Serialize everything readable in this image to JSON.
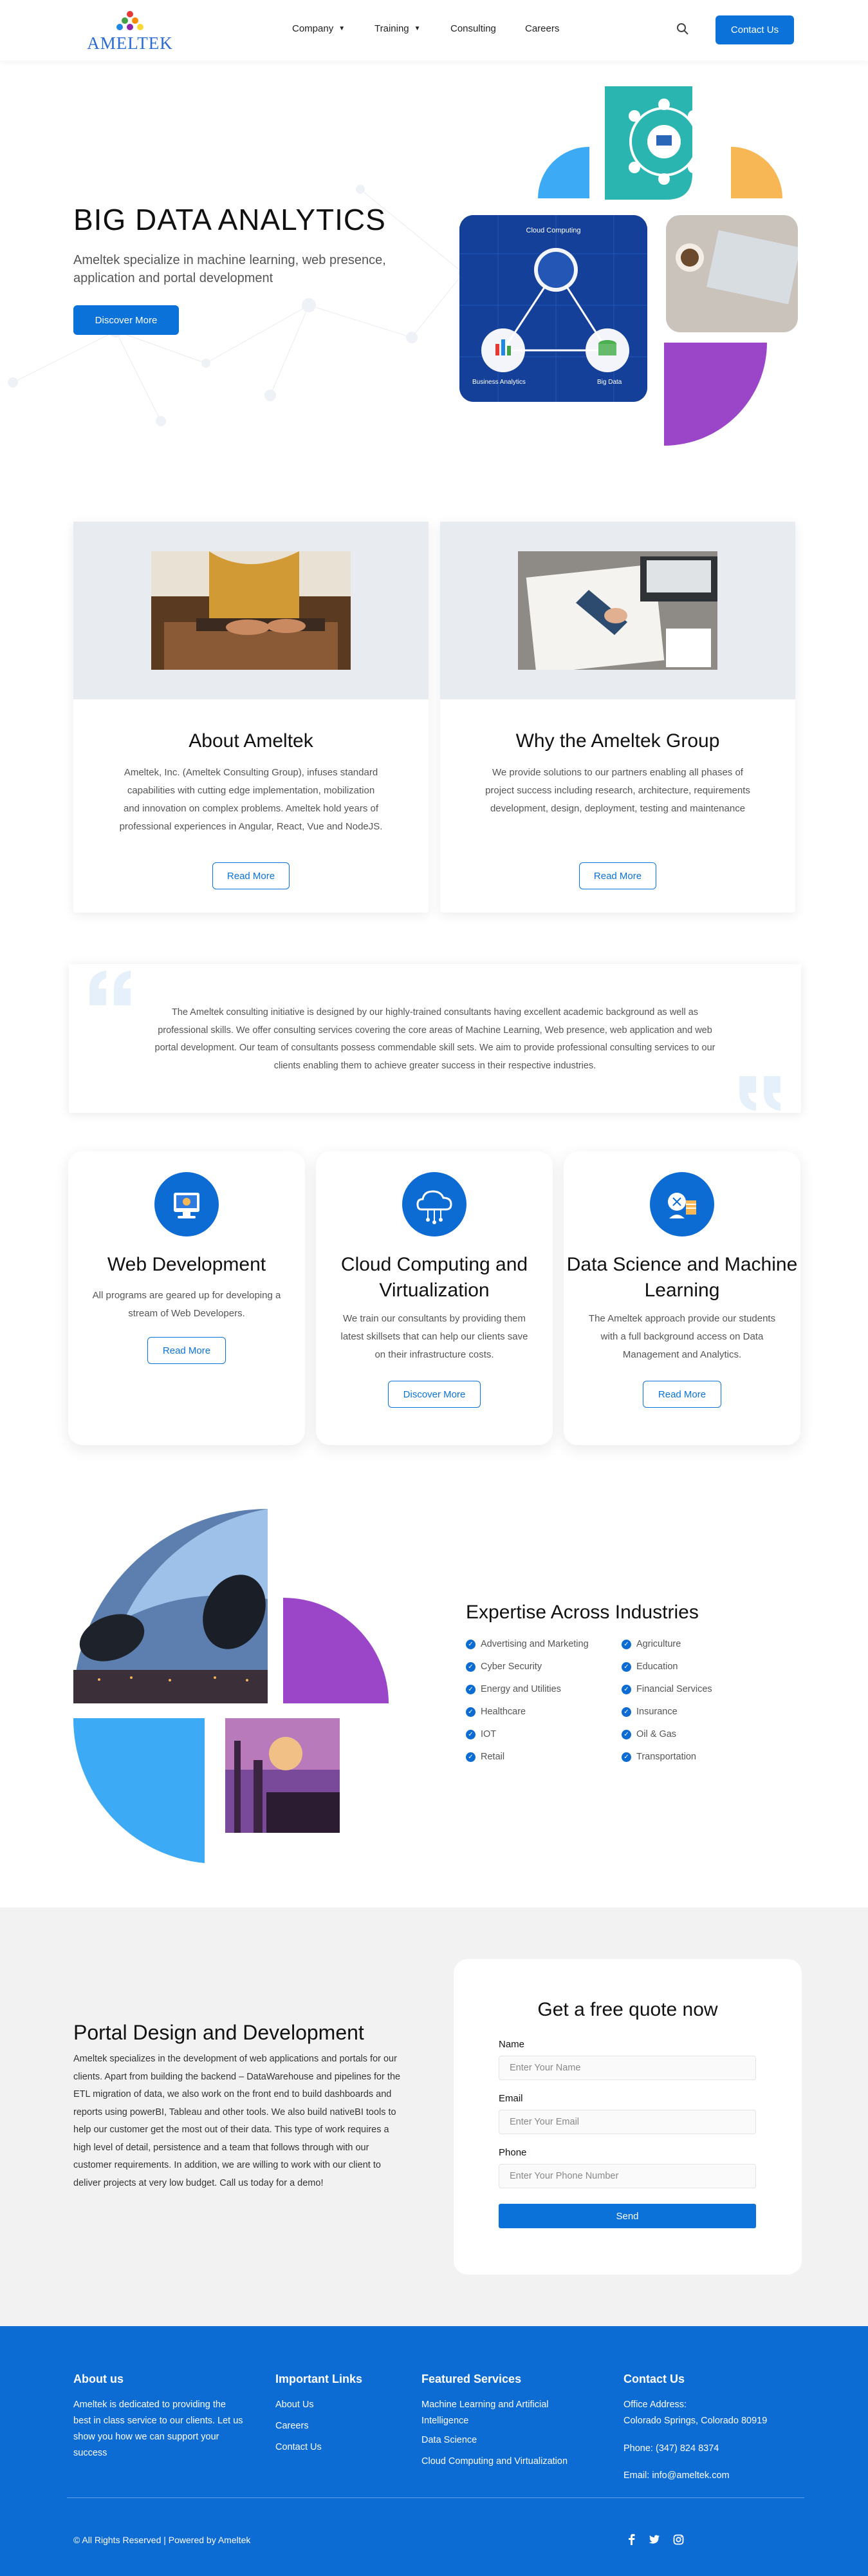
{
  "header": {
    "logo_text": "AMELTEK",
    "nav": [
      {
        "label": "Company",
        "has_dropdown": true
      },
      {
        "label": "Training",
        "has_dropdown": true
      },
      {
        "label": "Consulting",
        "has_dropdown": false
      },
      {
        "label": "Careers",
        "has_dropdown": false
      }
    ],
    "search_icon": "search-icon",
    "cta_label": "Contact Us"
  },
  "hero": {
    "title": "BIG DATA ANALYTICS",
    "subtitle": "Ameltek specialize in machine learning, web presence, application and portal development",
    "button_label": "Discover More",
    "diagram_labels": {
      "top": "Cloud Computing",
      "left": "Business Analytics",
      "right": "Big Data"
    }
  },
  "about_cards": [
    {
      "title": "About Ameltek",
      "text": "Ameltek, Inc. (Ameltek Consulting Group), infuses standard capabilities with cutting edge implementation, mobilization and innovation on complex problems. Ameltek hold years of professional experiences in Angular, React, Vue and NodeJS.",
      "button_label": "Read More"
    },
    {
      "title": "Why the Ameltek Group",
      "text": "We provide solutions to our partners enabling all phases of project success including research, architecture, requirements development, design, deployment, testing and maintenance",
      "button_label": "Read More"
    }
  ],
  "quote": {
    "text": "The Ameltek consulting initiative is designed by our highly-trained consultants having excellent academic background as well as professional skills. We offer consulting services covering the core areas of Machine Learning, Web presence, web application and web portal development. Our team of consultants possess commendable skill sets. We aim to provide professional consulting services to our clients enabling them to achieve greater success in their respective industries."
  },
  "services": [
    {
      "title": "Web Development",
      "text": "All programs are geared up for developing a stream of Web Developers.",
      "button_label": "Read More",
      "icon": "web-development-icon"
    },
    {
      "title": "Cloud Computing and Virtualization",
      "text": "We train our consultants by providing them latest skillsets that can help our clients save on their infrastructure costs.",
      "button_label": "Discover More",
      "icon": "cloud-icon"
    },
    {
      "title": "Data Science and Machine Learning",
      "text": "The Ameltek approach provide our students with a full background access on Data Management and Analytics.",
      "button_label": "Read More",
      "icon": "data-science-icon"
    }
  ],
  "industries": {
    "title": "Expertise Across Industries",
    "left": [
      "Advertising and Marketing",
      "Cyber Security",
      "Energy and Utilities",
      "Healthcare",
      "IOT",
      "Retail"
    ],
    "right": [
      "Agriculture",
      "Education",
      "Financial Services",
      "Insurance",
      "Oil & Gas",
      "Transportation"
    ]
  },
  "portal": {
    "title": "Portal Design and Development",
    "text": "Ameltek specializes in the development of web applications and portals for our clients.   Apart from building the backend – DataWarehouse and pipelines for the ETL migration of data, we also work on the front end to build dashboards and reports using powerBI, Tableau and other tools.   We also build nativeBI tools to help our customer get the most out of their data.   This type of work requires a high level of detail, persistence and a team that follows through with our customer requirements.   In addition, we are willing to work with our client to deliver projects at very low budget.  Call us today for a demo!"
  },
  "quote_form": {
    "title": "Get a free quote now",
    "name_label": "Name",
    "name_placeholder": "Enter Your Name",
    "email_label": "Email",
    "email_placeholder": "Enter Your Email",
    "phone_label": "Phone",
    "phone_placeholder": "Enter Your Phone Number",
    "submit_label": "Send"
  },
  "footer": {
    "about_title": "About us",
    "about_text": "Ameltek is dedicated to providing the best in class service to our clients. Let us show you how we can support your success",
    "links_title": "Important Links",
    "links": [
      "About Us",
      "Careers",
      "Contact Us"
    ],
    "services_title": "Featured Services",
    "services": [
      "Machine Learning and Artificial Intelligence",
      "Data Science",
      "Cloud Computing and Virtualization"
    ],
    "contact_title": "Contact Us",
    "address_label": "Office Address:",
    "address": "Colorado Springs, Colorado 80919",
    "phone": "Phone: (347) 824 8374",
    "email": "Email: info@ameltek.com",
    "copyright": "© All Rights Reserved | Powered by Ameltek",
    "social": [
      "facebook-icon",
      "twitter-icon",
      "instagram-icon"
    ]
  },
  "colors": {
    "primary": "#0d6bd4",
    "accent_blue": "#3daaf5",
    "accent_orange": "#f7b754",
    "accent_purple": "#9b45c9",
    "teal": "#2bb5b0",
    "light_gray": "#f2f2f2"
  }
}
